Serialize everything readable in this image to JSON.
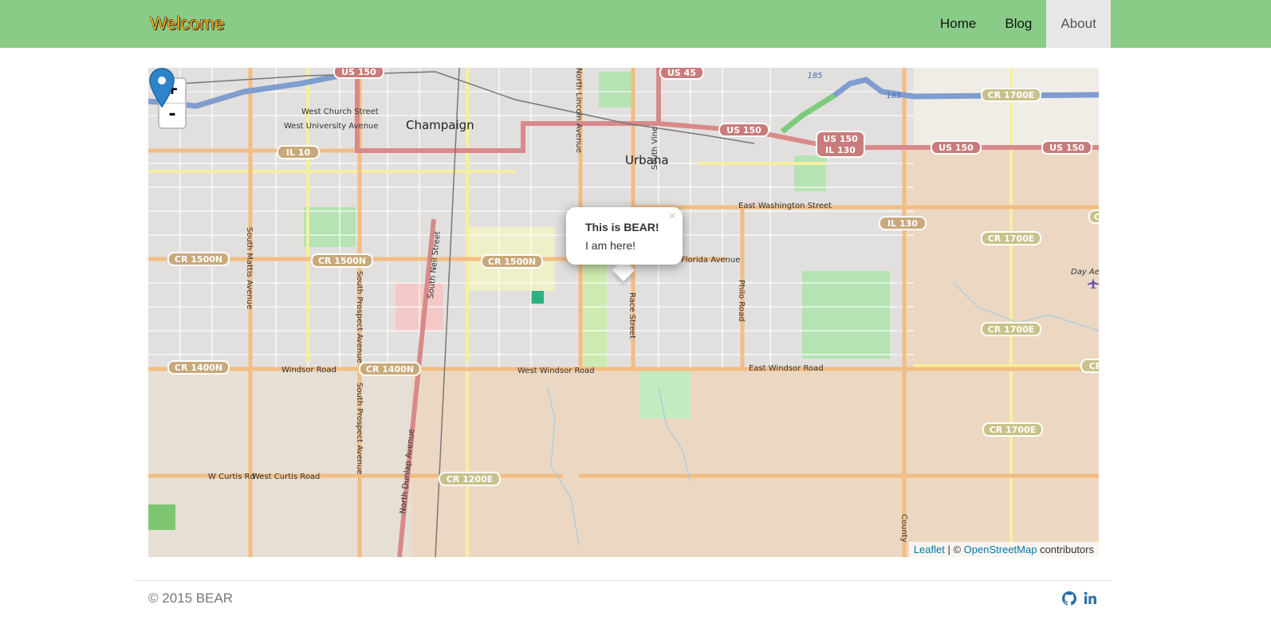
{
  "navbar": {
    "brand": "Welcome",
    "items": [
      {
        "label": "Home",
        "active": false
      },
      {
        "label": "Blog",
        "active": false
      },
      {
        "label": "About",
        "active": true
      }
    ],
    "bg_color": "#89cc88",
    "brand_color": "#f0a81c"
  },
  "map": {
    "zoom_in": "+",
    "zoom_out": "-",
    "popup": {
      "title": "This is BEAR!",
      "text": "I am here!",
      "close": "×"
    },
    "attribution": {
      "leaflet": "Leaflet",
      "sep": " | © ",
      "osm": "OpenStreetMap",
      "suffix": " contributors"
    },
    "labels": {
      "champaign": "Champaign",
      "urbana": "Urbana",
      "west_church": "West Church Street",
      "west_university": "West University Avenue",
      "east_washington": "East Washington Street",
      "florida": "Florida Avenue",
      "windsor": "Windsor Road",
      "west_windsor": "West Windsor Road",
      "east_windsor": "East Windsor Road",
      "w_curtis": "W Curtis Rd",
      "west_curtis": "West Curtis Road",
      "south_mattis": "South Mattis Avenue",
      "south_prospect": "South Prospect Avenue",
      "south_prospect2": "South Prospect Avenue",
      "south_neil": "South Neil Street",
      "north_dunlap": "North Dunlap Avenue",
      "north_lincoln": "North Lincoln Avenue",
      "south_vine": "South Vine",
      "race": "Race Street",
      "philo": "Philo Road",
      "county": "County",
      "day_aero": "Day Aero"
    },
    "shields": {
      "us150_a": "US 150",
      "us45": "US 45",
      "i185_a": "185",
      "i185_b": "185",
      "cr1700e_a": "CR 1700E",
      "us150_b": "US 150",
      "us150_c": "US 150",
      "il130_a": "IL 130",
      "us150_d": "US 150",
      "us150_e": "US 150",
      "il10": "IL 10",
      "il130_b": "IL 130",
      "cr1700e_b": "CR 1700E",
      "cr1500n_a": "CR 1500N",
      "cr1500n_b": "CR 1500N",
      "cr1500n_c": "CR 1500N",
      "cr1700e_c": "CR 1700E",
      "cr1400n_a": "CR 1400N",
      "cr1400n_b": "CR 1400N",
      "cr1700e_d": "CR 1700E",
      "cr1200e": "CR 1200E",
      "cr_edge": "CR",
      "c_edge": "C"
    }
  },
  "footer": {
    "copyright": "© 2015 BEAR",
    "icons": [
      "github-icon",
      "linkedin-icon"
    ],
    "link_color": "#2a6fa8"
  }
}
